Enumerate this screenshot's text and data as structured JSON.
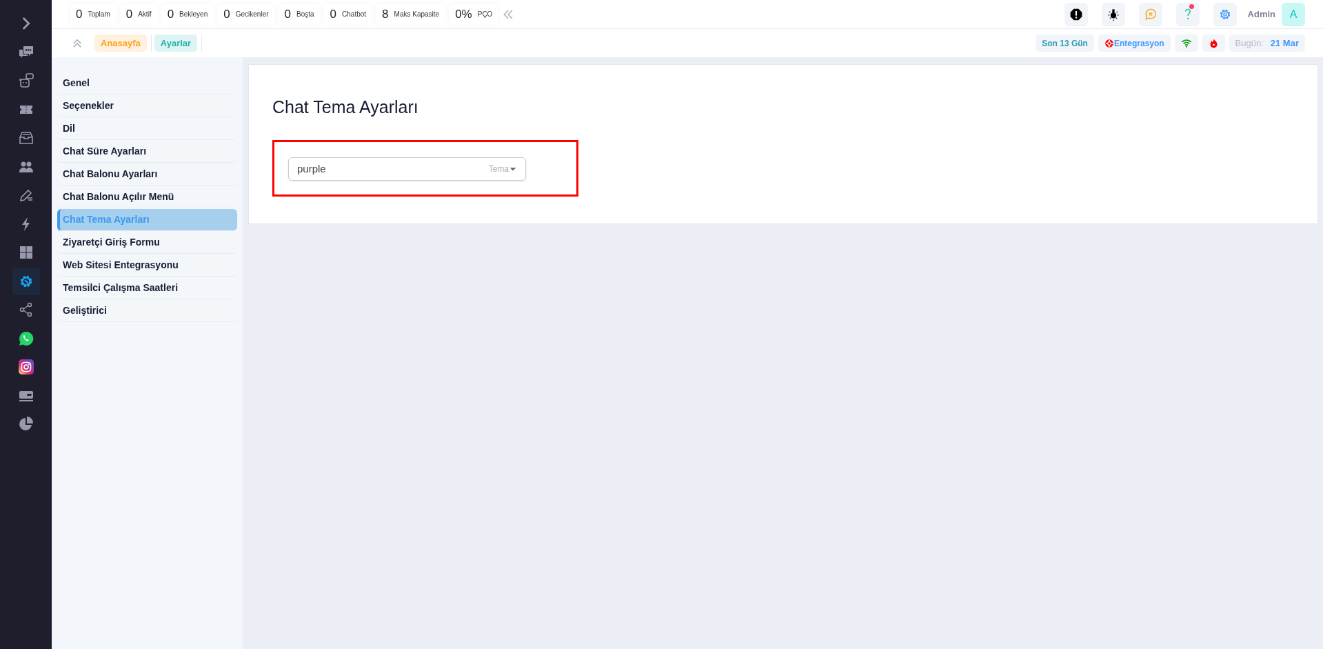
{
  "sidebar": {
    "items": [
      {
        "kind": "expand",
        "selected": false
      },
      {
        "kind": "chats",
        "selected": false
      },
      {
        "kind": "bot",
        "selected": false
      },
      {
        "kind": "ticket",
        "selected": false
      },
      {
        "kind": "archive",
        "selected": false
      },
      {
        "kind": "users",
        "selected": false
      },
      {
        "kind": "edit",
        "selected": false
      },
      {
        "kind": "bolt",
        "selected": false
      },
      {
        "kind": "grid",
        "selected": false
      },
      {
        "kind": "settings",
        "selected": true
      },
      {
        "kind": "share",
        "selected": false
      },
      {
        "kind": "whatsapp",
        "selected": false
      },
      {
        "kind": "instagram",
        "selected": false
      },
      {
        "kind": "card",
        "selected": false
      },
      {
        "kind": "pie",
        "selected": false
      }
    ]
  },
  "stats": [
    {
      "value": "0",
      "label": "Toplam"
    },
    {
      "value": "0",
      "label": "Aktif"
    },
    {
      "value": "0",
      "label": "Bekleyen"
    },
    {
      "value": "0",
      "label": "Gecikenler"
    },
    {
      "value": "0",
      "label": "Boşta"
    },
    {
      "value": "0",
      "label": "Chatbot"
    },
    {
      "value": "8",
      "label": "Maks Kapasite"
    },
    {
      "value": "0%",
      "label": "PÇO"
    }
  ],
  "top_icons": [
    {
      "kind": "alert",
      "notified": false
    },
    {
      "kind": "bulb",
      "notified": false
    },
    {
      "kind": "chat",
      "notified": false
    },
    {
      "kind": "help",
      "notified": true
    },
    {
      "kind": "settings",
      "notified": false
    }
  ],
  "user": {
    "name": "Admin",
    "initial": "A"
  },
  "breadcrumb": [
    {
      "label": "Anasayfa",
      "color": "#ff9f1c"
    },
    {
      "label": "Ayarlar",
      "color": "#20b2aa"
    }
  ],
  "status": {
    "period": "Son 13 Gün",
    "integration": "Entegrasyon",
    "today_label": "Bugün:",
    "today": "21 Mar"
  },
  "menu": [
    {
      "label": "Genel",
      "selected": false
    },
    {
      "label": "Seçenekler",
      "selected": false
    },
    {
      "label": "Dil",
      "selected": false
    },
    {
      "label": "Chat Süre Ayarları",
      "selected": false
    },
    {
      "label": "Chat Balonu Ayarları",
      "selected": false
    },
    {
      "label": "Chat Balonu Açılır Menü",
      "selected": false
    },
    {
      "label": "Chat Tema Ayarları",
      "selected": true
    },
    {
      "label": "Ziyaretçi Giriş Formu",
      "selected": false
    },
    {
      "label": "Web Sitesi Entegrasyonu",
      "selected": false
    },
    {
      "label": "Temsilci Çalışma Saatleri",
      "selected": false
    },
    {
      "label": "Geliştirici",
      "selected": false
    }
  ],
  "content": {
    "title": "Chat Tema Ayarları",
    "select": {
      "value": "purple",
      "label": "Tema",
      "highlighted": true
    }
  }
}
